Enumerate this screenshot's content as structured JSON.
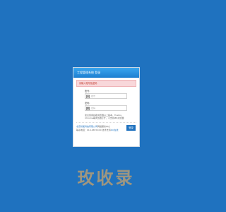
{
  "login_panel": {
    "title": "工程管理系统 登录",
    "alert_text": "请输入账号及密码",
    "username": {
      "label": "账号:",
      "placeholder": "账号",
      "icon": "user-icon"
    },
    "password": {
      "label": "密码:",
      "placeholder": "密码",
      "icon": "lock-icon"
    },
    "hint_text": "建议使用谷歌浏览器以上版本、Firefox、Chrome等浏览器打开，不支持IE6浏览器",
    "footer": {
      "line1_link": "北京智能科技有限公司",
      "line1_text": "网络服务中心",
      "line2_text": "联系电话：010-687XXXX 技术支持",
      "line2_link": "QQ在线"
    },
    "login_button": "登录"
  },
  "watermark": "玫收录",
  "colors": {
    "background": "#1f72bf",
    "header": "#2b95e3",
    "alert_bg": "#f8d7da",
    "button": "#1f72bf",
    "watermark": "#c9a26b"
  }
}
